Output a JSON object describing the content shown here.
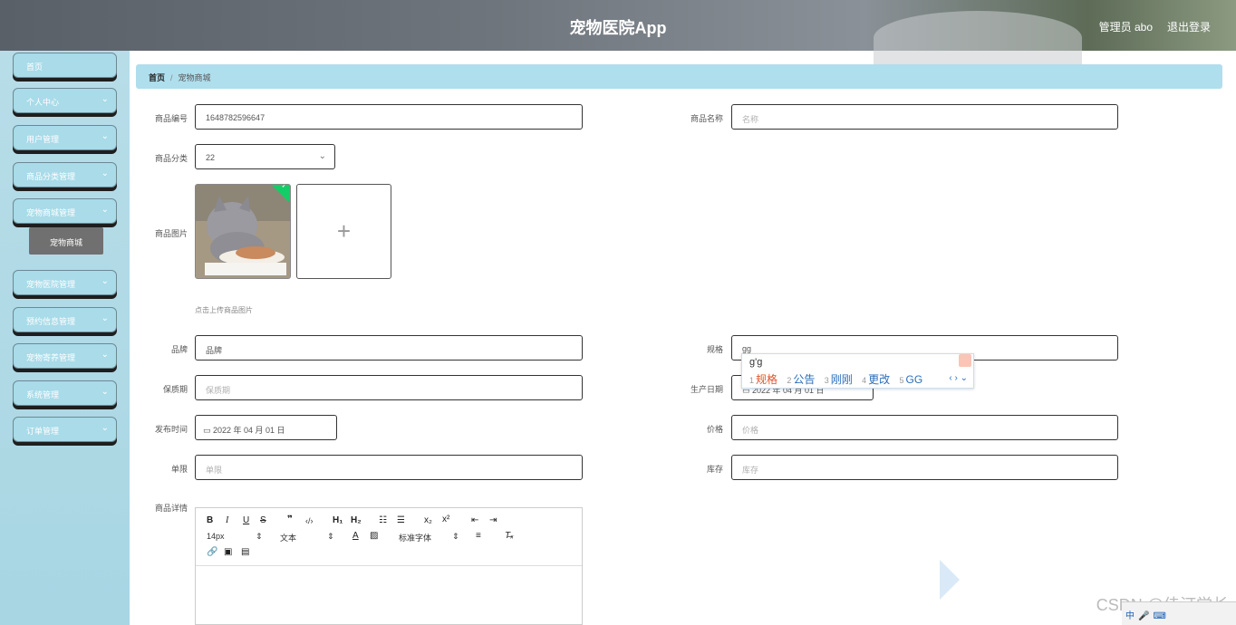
{
  "header": {
    "title": "宠物医院App",
    "user": "管理员 abo",
    "logout": "退出登录"
  },
  "sidebar": {
    "items": [
      {
        "label": "首页",
        "has_chevron": false
      },
      {
        "label": "个人中心",
        "has_chevron": true
      },
      {
        "label": "用户管理",
        "has_chevron": true
      },
      {
        "label": "商品分类管理",
        "has_chevron": true
      },
      {
        "label": "宠物商城管理",
        "has_chevron": true
      },
      {
        "label": "宠物医院管理",
        "has_chevron": true
      },
      {
        "label": "预约信息管理",
        "has_chevron": true
      },
      {
        "label": "宠物寄养管理",
        "has_chevron": true
      },
      {
        "label": "系统管理",
        "has_chevron": true
      },
      {
        "label": "订单管理",
        "has_chevron": true
      }
    ],
    "active_sub": "宠物商城"
  },
  "breadcrumb": {
    "home": "首页",
    "sep": "/",
    "current": "宠物商城"
  },
  "form": {
    "product_no": {
      "label": "商品编号",
      "value": "1648782596647"
    },
    "product_name": {
      "label": "商品名称",
      "placeholder": "名称"
    },
    "category": {
      "label": "商品分类",
      "value": "22"
    },
    "image": {
      "label": "商品图片",
      "hint": "点击上传商品图片"
    },
    "brand": {
      "label": "品牌",
      "value": "品牌"
    },
    "spec": {
      "label": "规格",
      "value": "gg"
    },
    "shelf_life": {
      "label": "保质期",
      "placeholder": "保质期"
    },
    "production_date": {
      "label": "生产日期",
      "value": "2022 年 04 月 01 日"
    },
    "publish_time": {
      "label": "发布时间",
      "value": "2022 年 04 月 01 日"
    },
    "price": {
      "label": "价格",
      "placeholder": "价格"
    },
    "limit": {
      "label": "单限",
      "placeholder": "单限"
    },
    "stock": {
      "label": "库存",
      "placeholder": "库存"
    },
    "detail": {
      "label": "商品详情"
    }
  },
  "ime": {
    "composition": "g'g",
    "candidates": [
      {
        "n": "1",
        "text": "规格"
      },
      {
        "n": "2",
        "text": "公告"
      },
      {
        "n": "3",
        "text": "刚刚"
      },
      {
        "n": "4",
        "text": "更改"
      },
      {
        "n": "5",
        "text": "GG"
      }
    ]
  },
  "editor": {
    "font_size": "14px",
    "text_type": "文本",
    "font_family": "标准字体"
  },
  "watermark": "CSDN @佳汀学长",
  "colors": {
    "sidebar": "#a9dbe9",
    "breadcrumb": "#afdeed",
    "upload_ok": "#13ce66"
  }
}
